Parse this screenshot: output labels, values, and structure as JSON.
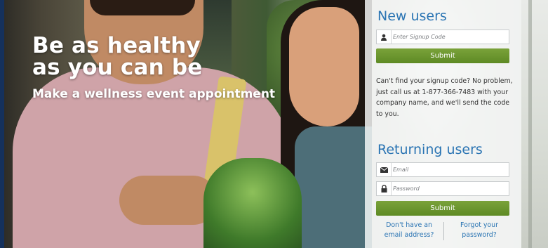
{
  "hero": {
    "headline_line1": "Be as healthy",
    "headline_line2": "as you can be",
    "subheadline": "Make a wellness event appointment"
  },
  "new_users": {
    "title": "New users",
    "signup_code_placeholder": "Enter Signup Code",
    "signup_code_value": "",
    "submit_label": "Submit",
    "help_text": "Can't find your signup code? No problem, just call us at 1-877-366-7483 with your company name, and we'll send the code to you."
  },
  "returning_users": {
    "title": "Returning users",
    "email_placeholder": "Email",
    "email_value": "",
    "password_placeholder": "Password",
    "password_value": "",
    "submit_label": "Submit",
    "no_email_link": "Don't have an email address?",
    "forgot_password_link": "Forgot your password?"
  },
  "colors": {
    "accent_blue": "#2a74b3",
    "button_green": "#6a962e"
  },
  "icons": [
    "user-icon",
    "envelope-icon",
    "lock-icon"
  ]
}
